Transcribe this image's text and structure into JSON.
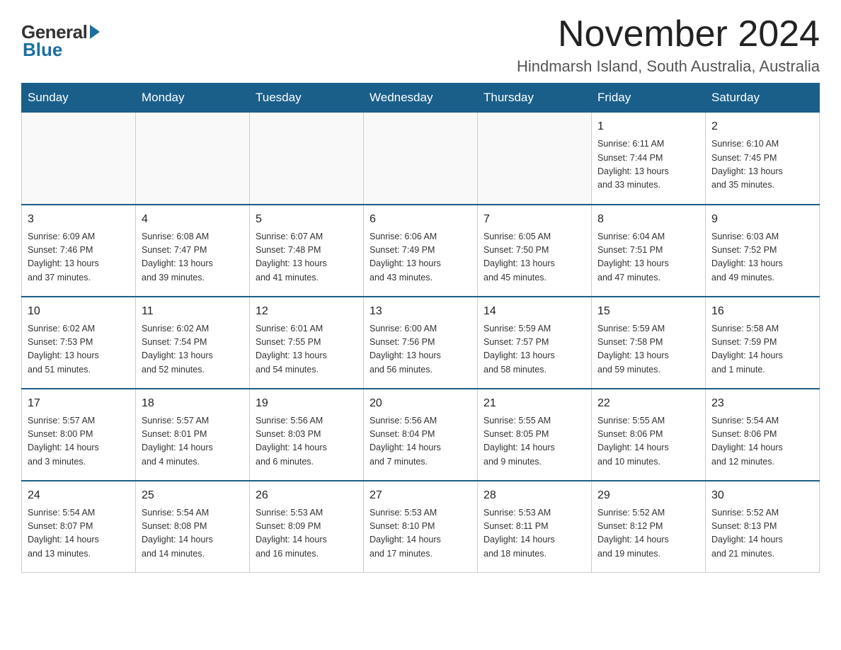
{
  "logo": {
    "general": "General",
    "blue": "Blue"
  },
  "header": {
    "month_year": "November 2024",
    "location": "Hindmarsh Island, South Australia, Australia"
  },
  "days_of_week": [
    "Sunday",
    "Monday",
    "Tuesday",
    "Wednesday",
    "Thursday",
    "Friday",
    "Saturday"
  ],
  "weeks": [
    [
      {
        "day": "",
        "info": ""
      },
      {
        "day": "",
        "info": ""
      },
      {
        "day": "",
        "info": ""
      },
      {
        "day": "",
        "info": ""
      },
      {
        "day": "",
        "info": ""
      },
      {
        "day": "1",
        "info": "Sunrise: 6:11 AM\nSunset: 7:44 PM\nDaylight: 13 hours\nand 33 minutes."
      },
      {
        "day": "2",
        "info": "Sunrise: 6:10 AM\nSunset: 7:45 PM\nDaylight: 13 hours\nand 35 minutes."
      }
    ],
    [
      {
        "day": "3",
        "info": "Sunrise: 6:09 AM\nSunset: 7:46 PM\nDaylight: 13 hours\nand 37 minutes."
      },
      {
        "day": "4",
        "info": "Sunrise: 6:08 AM\nSunset: 7:47 PM\nDaylight: 13 hours\nand 39 minutes."
      },
      {
        "day": "5",
        "info": "Sunrise: 6:07 AM\nSunset: 7:48 PM\nDaylight: 13 hours\nand 41 minutes."
      },
      {
        "day": "6",
        "info": "Sunrise: 6:06 AM\nSunset: 7:49 PM\nDaylight: 13 hours\nand 43 minutes."
      },
      {
        "day": "7",
        "info": "Sunrise: 6:05 AM\nSunset: 7:50 PM\nDaylight: 13 hours\nand 45 minutes."
      },
      {
        "day": "8",
        "info": "Sunrise: 6:04 AM\nSunset: 7:51 PM\nDaylight: 13 hours\nand 47 minutes."
      },
      {
        "day": "9",
        "info": "Sunrise: 6:03 AM\nSunset: 7:52 PM\nDaylight: 13 hours\nand 49 minutes."
      }
    ],
    [
      {
        "day": "10",
        "info": "Sunrise: 6:02 AM\nSunset: 7:53 PM\nDaylight: 13 hours\nand 51 minutes."
      },
      {
        "day": "11",
        "info": "Sunrise: 6:02 AM\nSunset: 7:54 PM\nDaylight: 13 hours\nand 52 minutes."
      },
      {
        "day": "12",
        "info": "Sunrise: 6:01 AM\nSunset: 7:55 PM\nDaylight: 13 hours\nand 54 minutes."
      },
      {
        "day": "13",
        "info": "Sunrise: 6:00 AM\nSunset: 7:56 PM\nDaylight: 13 hours\nand 56 minutes."
      },
      {
        "day": "14",
        "info": "Sunrise: 5:59 AM\nSunset: 7:57 PM\nDaylight: 13 hours\nand 58 minutes."
      },
      {
        "day": "15",
        "info": "Sunrise: 5:59 AM\nSunset: 7:58 PM\nDaylight: 13 hours\nand 59 minutes."
      },
      {
        "day": "16",
        "info": "Sunrise: 5:58 AM\nSunset: 7:59 PM\nDaylight: 14 hours\nand 1 minute."
      }
    ],
    [
      {
        "day": "17",
        "info": "Sunrise: 5:57 AM\nSunset: 8:00 PM\nDaylight: 14 hours\nand 3 minutes."
      },
      {
        "day": "18",
        "info": "Sunrise: 5:57 AM\nSunset: 8:01 PM\nDaylight: 14 hours\nand 4 minutes."
      },
      {
        "day": "19",
        "info": "Sunrise: 5:56 AM\nSunset: 8:03 PM\nDaylight: 14 hours\nand 6 minutes."
      },
      {
        "day": "20",
        "info": "Sunrise: 5:56 AM\nSunset: 8:04 PM\nDaylight: 14 hours\nand 7 minutes."
      },
      {
        "day": "21",
        "info": "Sunrise: 5:55 AM\nSunset: 8:05 PM\nDaylight: 14 hours\nand 9 minutes."
      },
      {
        "day": "22",
        "info": "Sunrise: 5:55 AM\nSunset: 8:06 PM\nDaylight: 14 hours\nand 10 minutes."
      },
      {
        "day": "23",
        "info": "Sunrise: 5:54 AM\nSunset: 8:06 PM\nDaylight: 14 hours\nand 12 minutes."
      }
    ],
    [
      {
        "day": "24",
        "info": "Sunrise: 5:54 AM\nSunset: 8:07 PM\nDaylight: 14 hours\nand 13 minutes."
      },
      {
        "day": "25",
        "info": "Sunrise: 5:54 AM\nSunset: 8:08 PM\nDaylight: 14 hours\nand 14 minutes."
      },
      {
        "day": "26",
        "info": "Sunrise: 5:53 AM\nSunset: 8:09 PM\nDaylight: 14 hours\nand 16 minutes."
      },
      {
        "day": "27",
        "info": "Sunrise: 5:53 AM\nSunset: 8:10 PM\nDaylight: 14 hours\nand 17 minutes."
      },
      {
        "day": "28",
        "info": "Sunrise: 5:53 AM\nSunset: 8:11 PM\nDaylight: 14 hours\nand 18 minutes."
      },
      {
        "day": "29",
        "info": "Sunrise: 5:52 AM\nSunset: 8:12 PM\nDaylight: 14 hours\nand 19 minutes."
      },
      {
        "day": "30",
        "info": "Sunrise: 5:52 AM\nSunset: 8:13 PM\nDaylight: 14 hours\nand 21 minutes."
      }
    ]
  ]
}
